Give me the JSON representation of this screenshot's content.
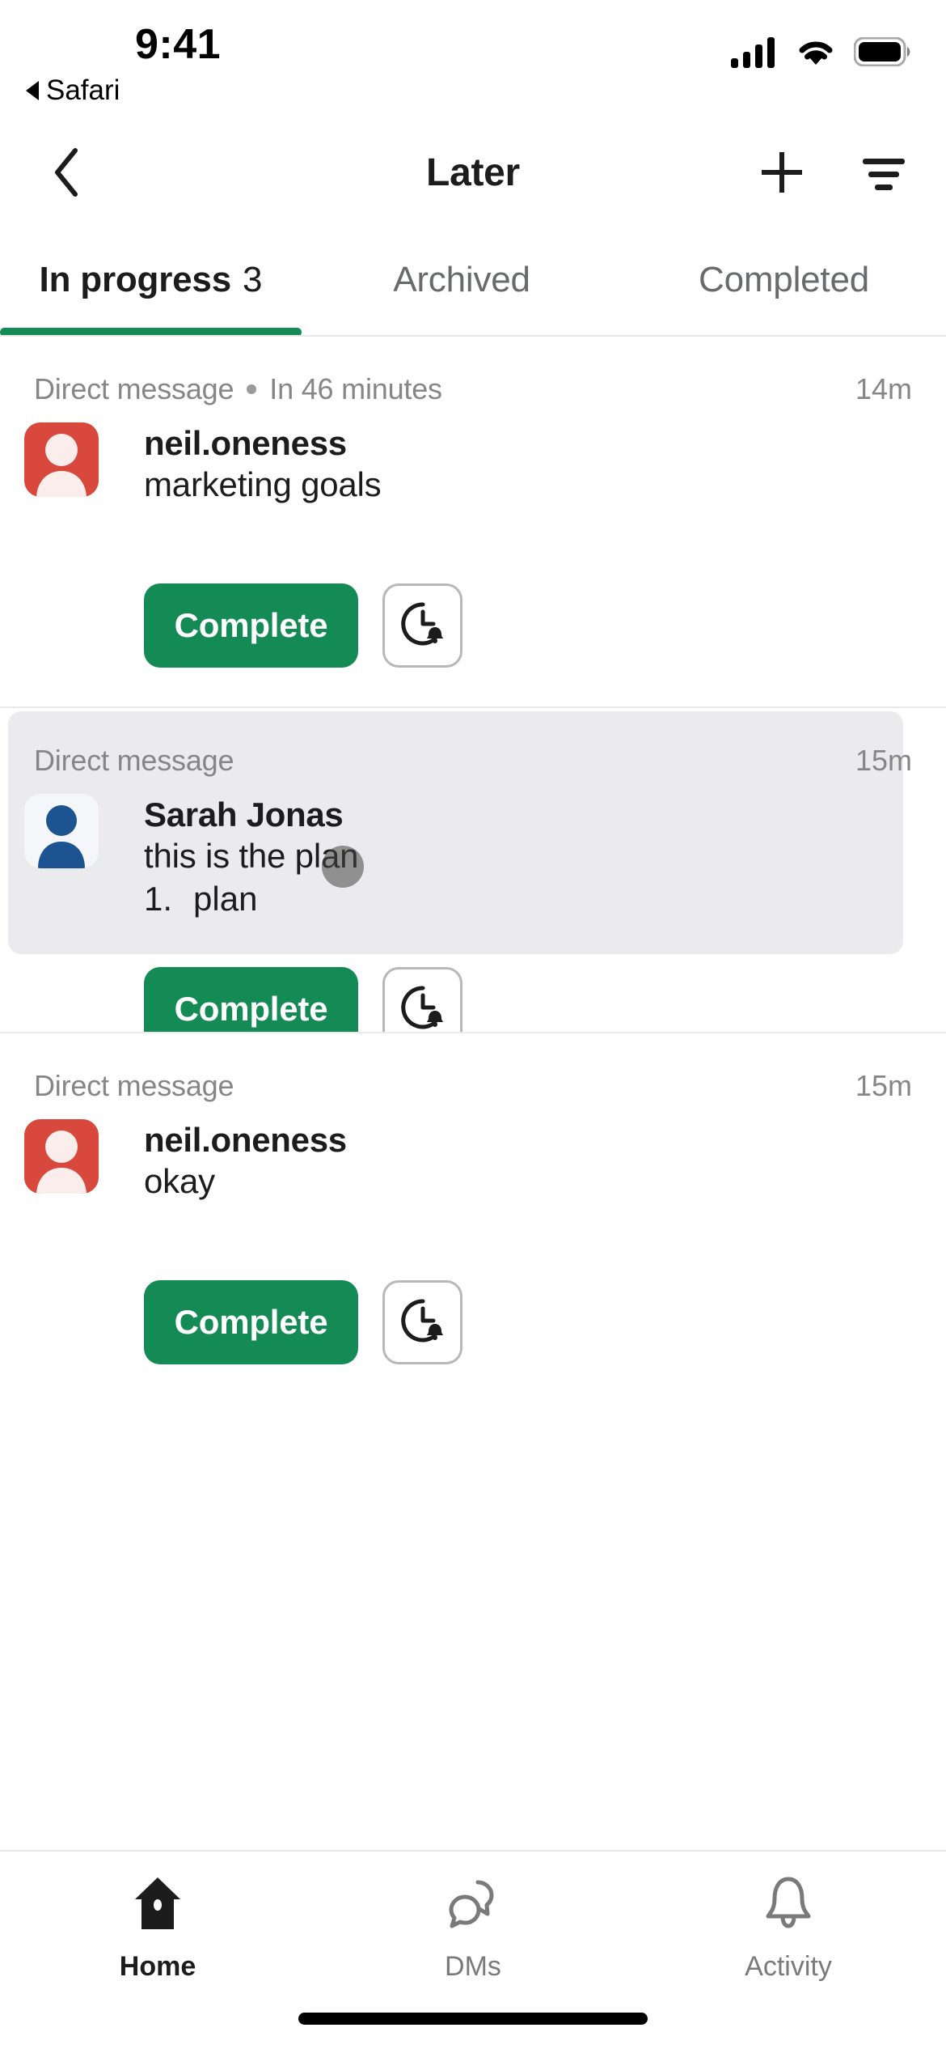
{
  "status_bar": {
    "time": "9:41",
    "back_app_label": "Safari",
    "back_triangle_icon": "back-triangle-icon",
    "cellular_icon": "cellular-signal-icon",
    "wifi_icon": "wifi-icon",
    "battery_icon": "battery-full-icon"
  },
  "nav": {
    "back_icon": "chevron-left-icon",
    "title": "Later",
    "add_icon": "plus-icon",
    "filter_icon": "filter-lines-icon"
  },
  "tabs": {
    "items": [
      {
        "label": "In progress",
        "count": "3",
        "active": true
      },
      {
        "label": "Archived",
        "count": "",
        "active": false
      },
      {
        "label": "Completed",
        "count": "",
        "active": false
      }
    ],
    "active_color": "#148A55"
  },
  "list": {
    "items": [
      {
        "source": "Direct message",
        "due": "In 46 minutes",
        "has_dot": true,
        "timestamp": "14m",
        "sender": "neil.oneness",
        "message": "marketing goals",
        "list_number": "",
        "list_text": "",
        "avatar_icon": "person-avatar-red-icon",
        "avatar_color": "#D8483C",
        "highlighted": false,
        "complete_label": "Complete",
        "snooze_icon": "clock-bell-reminder-icon"
      },
      {
        "source": "Direct message",
        "due": "",
        "has_dot": false,
        "timestamp": "15m",
        "sender": "Sarah Jonas",
        "message": "this is the plan",
        "list_number": "1.",
        "list_text": "plan",
        "avatar_icon": "person-avatar-blue-icon",
        "avatar_color": "#1B5490",
        "highlighted": true,
        "complete_label": "Complete",
        "snooze_icon": "clock-bell-reminder-icon"
      },
      {
        "source": "Direct message",
        "due": "",
        "has_dot": false,
        "timestamp": "15m",
        "sender": "neil.oneness",
        "message": "okay",
        "list_number": "",
        "list_text": "",
        "avatar_icon": "person-avatar-red-icon",
        "avatar_color": "#D8483C",
        "highlighted": false,
        "complete_label": "Complete",
        "snooze_icon": "clock-bell-reminder-icon"
      }
    ]
  },
  "bottom_bar": {
    "items": [
      {
        "label": "Home",
        "icon": "home-filled-icon",
        "active": true
      },
      {
        "label": "DMs",
        "icon": "speech-bubbles-icon",
        "active": false
      },
      {
        "label": "Activity",
        "icon": "bell-outline-icon",
        "active": false
      }
    ]
  }
}
